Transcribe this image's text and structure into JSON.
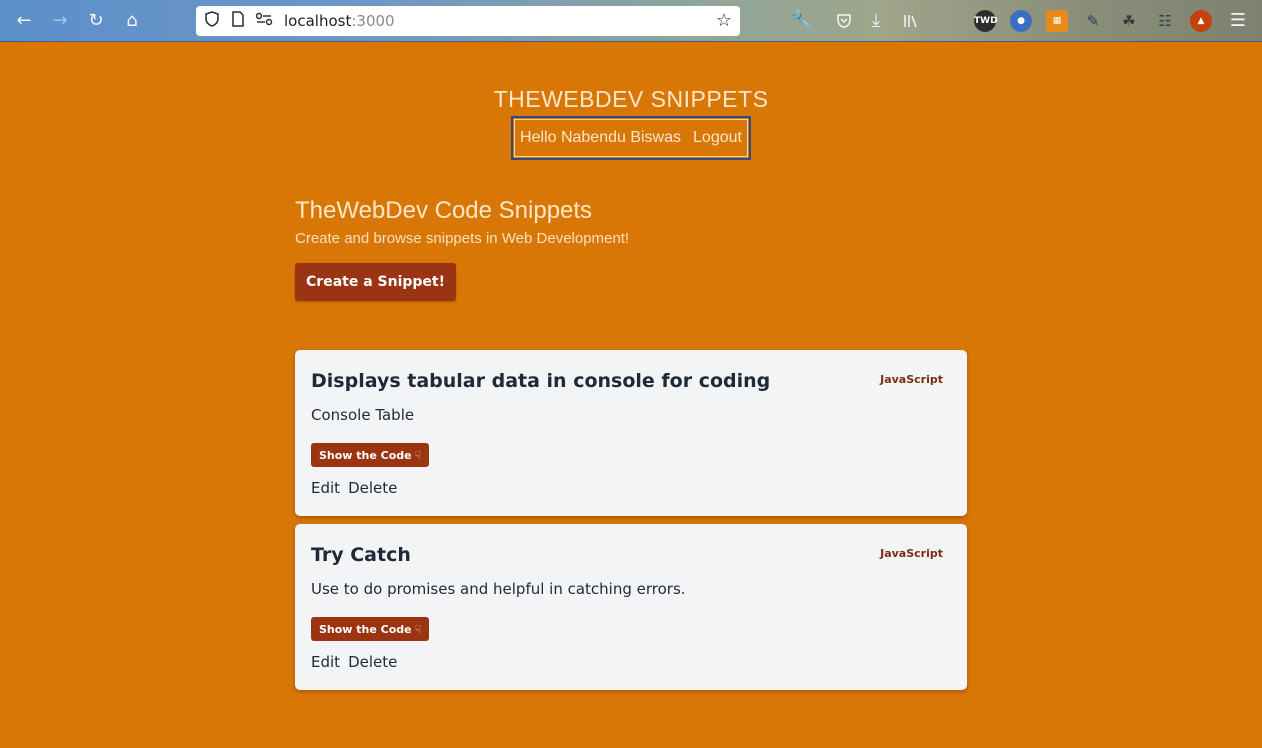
{
  "browser": {
    "url_host": "localhost",
    "url_port": ":3000",
    "icons": [
      "back-arrow-icon",
      "forward-arrow-icon",
      "reload-icon",
      "home-icon",
      "shield-icon",
      "page-icon",
      "permissions-icon",
      "bookmark-star-icon",
      "wrench-icon",
      "pocket-icon",
      "download-icon",
      "library-icon",
      "menu-icon"
    ],
    "ext_label": "TWD"
  },
  "header": {
    "site_title": "THEWEBDEV SNIPPETS",
    "greeting": "Hello Nabendu Biswas",
    "logout": "Logout"
  },
  "main": {
    "heading": "TheWebDev Code Snippets",
    "subheading": "Create and browse snippets in Web Development!",
    "create_label": "Create a Snippet!"
  },
  "snippets": [
    {
      "title": "Displays tabular data in console for coding",
      "language": "JavaScript",
      "description": "Console Table",
      "show_code": "Show the Code",
      "edit": "Edit",
      "delete": "Delete"
    },
    {
      "title": "Try Catch",
      "language": "JavaScript",
      "description": "Use to do promises and helpful in catching errors.",
      "show_code": "Show the Code",
      "edit": "Edit",
      "delete": "Delete"
    }
  ],
  "colors": {
    "page_bg": "#d97706",
    "accent": "#9a3412",
    "card_bg": "#f3f4f6"
  }
}
